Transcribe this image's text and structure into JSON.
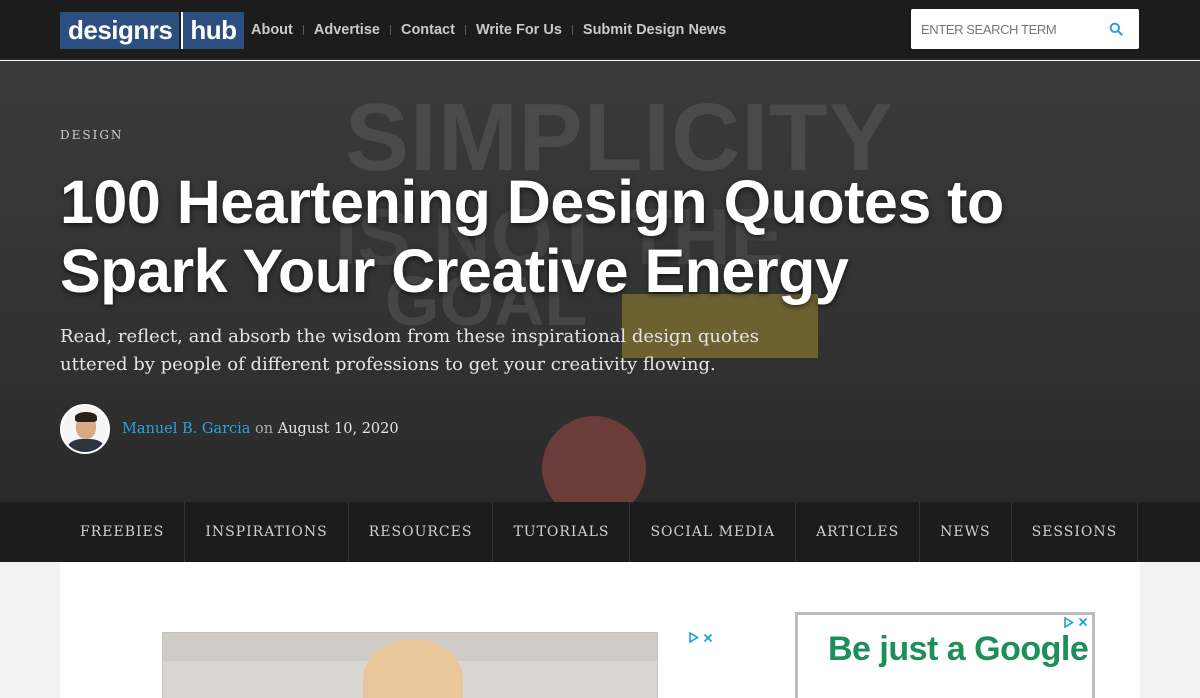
{
  "header": {
    "logo_part1": "designrs",
    "logo_part2": "hub",
    "nav": [
      "About",
      "Advertise",
      "Contact",
      "Write For Us",
      "Submit Design News"
    ],
    "search_placeholder": "ENTER SEARCH TERM"
  },
  "hero": {
    "background_words": [
      "SIMPLICITY",
      "IS NOT THE",
      "GOAL"
    ],
    "category": "DESIGN",
    "title": "100 Heartening Design Quotes to Spark Your Creative Energy",
    "subtitle": "Read, reflect, and absorb the wisdom from these inspirational design quotes uttered by people of different professions to get your creativity flowing.",
    "author": "Manuel B. Garcia",
    "on": "on",
    "date": "August 10, 2020"
  },
  "catnav": [
    "FREEBIES",
    "INSPIRATIONS",
    "RESOURCES",
    "TUTORIALS",
    "SOCIAL MEDIA",
    "ARTICLES",
    "NEWS",
    "SESSIONS"
  ],
  "ads": {
    "right_ad_text": "Be just a Google"
  },
  "colors": {
    "topbar": "#1c1c1c",
    "logo_blue": "#2d4f80",
    "author_link": "#2aa3e0",
    "ad_green": "#1e8e5a"
  }
}
